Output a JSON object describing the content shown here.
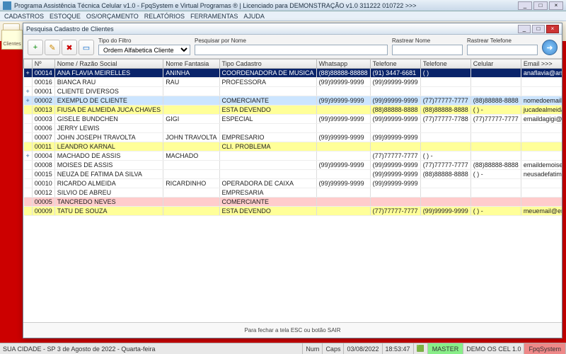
{
  "app": {
    "title": "Programa Assistência Técnica Celular v1.0 - FpqSystem e Virtual Programas ® | Licenciado para  DEMONSTRAÇÃO v1.0 311222 010722 >>>",
    "menus": [
      "CADASTROS",
      "ESTOQUE",
      "OS/ORÇAMENTO",
      "RELATÓRIOS",
      "FERRAMENTAS",
      "AJUDA"
    ],
    "tab_clientes": "Clientes"
  },
  "search": {
    "title": "Pesquisa Cadastro de Clientes",
    "filter_type_label": "Tipo do Filtro",
    "filter_type_value": "Ordem Alfabetica Cliente",
    "by_name_label": "Pesquisar por Nome",
    "by_name_value": "",
    "track_name_label": "Rastrear Nome",
    "track_name_value": "",
    "track_phone_label": "Rastrear Telefone",
    "track_phone_value": ""
  },
  "columns": [
    "",
    "Nº",
    "Nome / Razão Social",
    "Nome Fantasia",
    "Tipo Cadastro",
    "Whatsapp",
    "Telefone",
    "Telefone",
    "Celular",
    "Email >>>"
  ],
  "rows": [
    {
      "cls": "sel",
      "c": [
        "+",
        "00014",
        "ANA FLAVIA MEIRELLES",
        "ANINHA",
        "COORDENADORA DE MUSICA",
        "(88)88888-88888",
        "(91) 3447-6681",
        "( )",
        "",
        "anaflavia@anaflavia.com.br"
      ]
    },
    {
      "cls": "",
      "c": [
        "",
        "00016",
        "BIANCA RAU",
        "RAU",
        "PROFESSORA",
        "(99)99999-9999",
        "(99)99999-9999",
        "",
        "",
        ""
      ]
    },
    {
      "cls": "",
      "c": [
        "+",
        "00001",
        "CLIENTE DIVERSOS",
        "",
        "",
        "",
        "",
        "",
        "",
        ""
      ]
    },
    {
      "cls": "blue",
      "c": [
        "+",
        "00002",
        "EXEMPLO DE CLIENTE",
        "",
        "COMERCIANTE",
        "(99)99999-9999",
        "(99)99999-9999",
        "(77)77777-7777",
        "(88)88888-8888",
        "nomedoemail@email.com.br"
      ]
    },
    {
      "cls": "yel",
      "c": [
        "",
        "00013",
        "FIUSA DE ALMEIDA JUCA CHAVES",
        "",
        "ESTA DEVENDO",
        "",
        "(88)88888-8888",
        "(88)88888-8888",
        "( ) -",
        "jucadealmeida@jucadealmeida.com.b"
      ]
    },
    {
      "cls": "",
      "c": [
        "",
        "00003",
        "GISELE BUNDCHEN",
        "GIGI",
        "ESPECIAL",
        "(99)99999-9999",
        "(99)99999-9999",
        "(77)77777-7788",
        "(77)77777-7777",
        "emaildagigi@gigi.com.br"
      ]
    },
    {
      "cls": "",
      "c": [
        "",
        "00006",
        "JERRY LEWIS",
        "",
        "",
        "",
        "",
        "",
        "",
        ""
      ]
    },
    {
      "cls": "",
      "c": [
        "",
        "00007",
        "JOHN JOSEPH TRAVOLTA",
        "JOHN TRAVOLTA",
        "EMPRESARIO",
        "(99)99999-9999",
        "(99)99999-9999",
        "",
        "",
        ""
      ]
    },
    {
      "cls": "yel",
      "c": [
        "",
        "00011",
        "LEANDRO KARNAL",
        "",
        "CLI. PROBLEMA",
        "",
        "",
        "",
        "",
        ""
      ]
    },
    {
      "cls": "",
      "c": [
        "+",
        "00004",
        "MACHADO DE ASSIS",
        "MACHADO",
        "",
        "",
        "(77)77777-7777",
        "( ) -",
        "",
        ""
      ]
    },
    {
      "cls": "",
      "c": [
        "",
        "00008",
        "MOISES DE ASSIS",
        "",
        "",
        "(99)99999-9999",
        "(99)99999-9999",
        "(77)77777-7777",
        "(88)88888-8888",
        "emaildemoises@moises.com.br"
      ]
    },
    {
      "cls": "",
      "c": [
        "",
        "00015",
        "NEUZA DE FATIMA DA SILVA",
        "",
        "",
        "",
        "(99)99999-9999",
        "(88)88888-8888",
        "( ) -",
        "neusadefatima@fatima.com.br"
      ]
    },
    {
      "cls": "",
      "c": [
        "",
        "00010",
        "RICARDO ALMEIDA",
        "RICARDINHO",
        "OPERADORA DE CAIXA",
        "(99)99999-9999",
        "(99)99999-9999",
        "",
        "",
        ""
      ]
    },
    {
      "cls": "",
      "c": [
        "",
        "00012",
        "SILVIO DE ABREU",
        "",
        "EMPRESARIA",
        "",
        "",
        "",
        "",
        ""
      ]
    },
    {
      "cls": "pink",
      "c": [
        "",
        "00005",
        "TANCREDO NEVES",
        "",
        "COMERCIANTE",
        "",
        "",
        "",
        "",
        ""
      ]
    },
    {
      "cls": "yel",
      "c": [
        "",
        "00009",
        "TATU DE SOUZA",
        "",
        "ESTA DEVENDO",
        "",
        "(77)77777-7777",
        "(99)99999-9999",
        "( ) -",
        "meuemail@email.com.b"
      ]
    }
  ],
  "hint": "Para fechar a tela ESC ou botão SAIR",
  "status": {
    "location": "SUA CIDADE - SP  3 de Agosto de 2022 - Quarta-feira",
    "num": "Num",
    "caps": "Caps",
    "date": "03/08/2022",
    "time": "18:53:47",
    "user": "MASTER",
    "product": "DEMO OS CEL 1.0",
    "brand": "FpqSystem"
  }
}
